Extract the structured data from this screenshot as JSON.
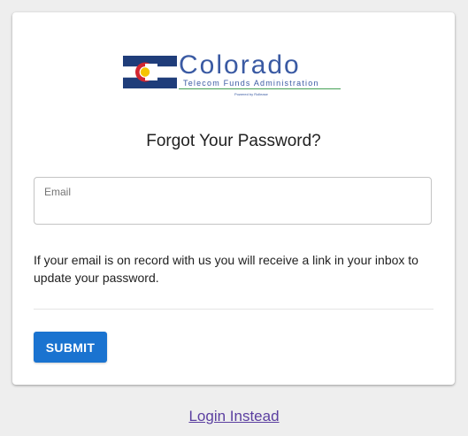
{
  "logo": {
    "wordmark": "Colorado",
    "subtitle": "Telecom Funds Administration",
    "powered_by": "Powered by Rollease",
    "colors": {
      "flag_blue": "#1f3d7a",
      "flag_red": "#d22630",
      "flag_gold": "#f5c400",
      "wordmark": "#3a5aa3",
      "rule": "#44a055"
    }
  },
  "form": {
    "title": "Forgot Your Password?",
    "email_label": "Email",
    "email_value": "",
    "info_text": "If your email is on record with us you will receive a link in your inbox to update your password.",
    "submit_label": "SUBMIT"
  },
  "footer": {
    "login_link": "Login Instead"
  },
  "colors": {
    "page_bg": "#eeeeee",
    "card_bg": "#ffffff",
    "primary": "#1a73d0",
    "link": "#5b3fa0"
  }
}
